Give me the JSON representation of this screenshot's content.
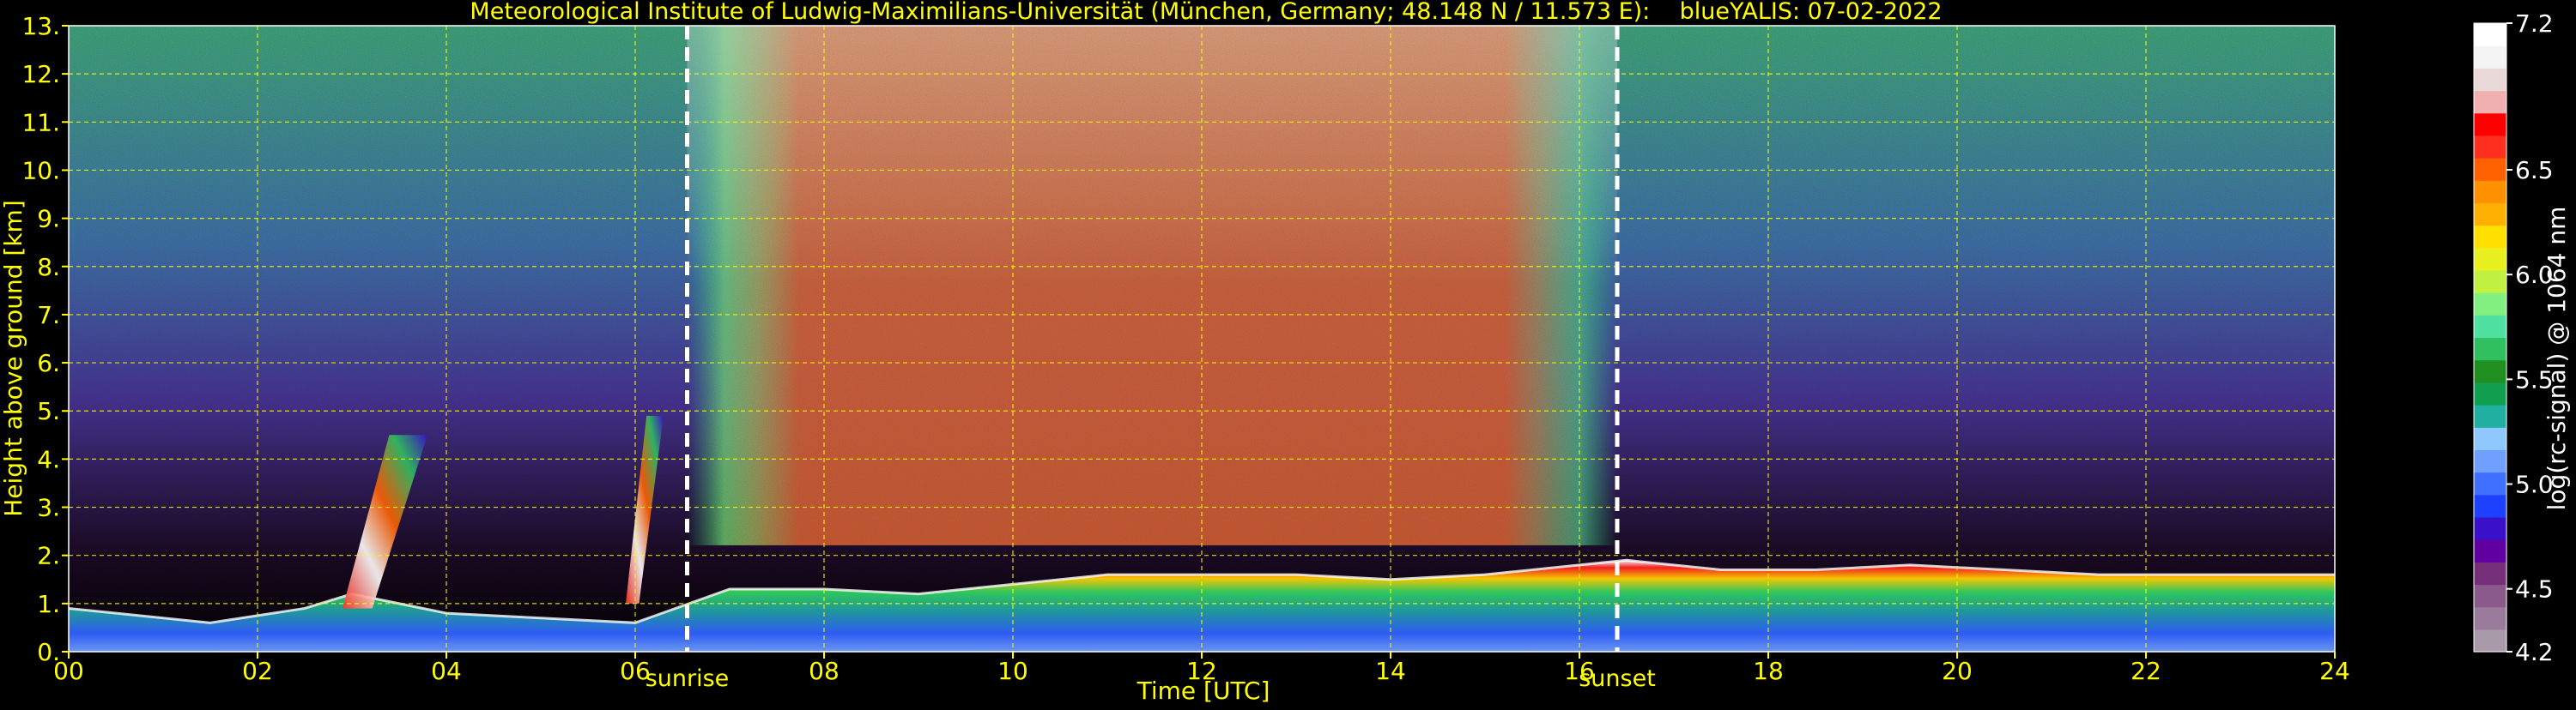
{
  "chart_data": {
    "type": "heatmap",
    "title": "Meteorological Institute of Ludwig-Maximilians-Universität (München, Germany; 48.148 N / 11.573 E):    blueYALIS: 07-02-2022",
    "xlabel": "Time [UTC]",
    "ylabel": "Height above ground [km]",
    "xlim": [
      0,
      24
    ],
    "ylim": [
      0,
      13
    ],
    "x_ticks": [
      0,
      2,
      4,
      6,
      8,
      10,
      12,
      14,
      16,
      18,
      20,
      22,
      24
    ],
    "x_tick_labels": [
      "00",
      "02",
      "04",
      "06",
      "08",
      "10",
      "12",
      "14",
      "16",
      "18",
      "20",
      "22",
      "24"
    ],
    "y_ticks": [
      0,
      1,
      2,
      3,
      4,
      5,
      6,
      7,
      8,
      9,
      10,
      11,
      12,
      13
    ],
    "y_tick_labels": [
      "0.",
      "1.",
      "2.",
      "3.",
      "4.",
      "5.",
      "6.",
      "7.",
      "8.",
      "9.",
      "10.",
      "11.",
      "12.",
      "13."
    ],
    "grid": true,
    "grid_color": "#ffff00",
    "annotations": [
      {
        "label": "sunrise",
        "x": 6.55
      },
      {
        "label": "sunset",
        "x": 16.4
      }
    ],
    "colorbar": {
      "label": "log(rc-signal) @ 1064 nm",
      "range": [
        4.2,
        7.2
      ],
      "tick_values": [
        4.2,
        4.5,
        5.0,
        5.5,
        6.0,
        6.5,
        7.2
      ],
      "tick_labels": [
        "4.2",
        "4.5",
        "5.0",
        "5.5",
        "6.0",
        "6.5",
        "7.2"
      ],
      "colors": [
        "#a89aa8",
        "#9b7b9b",
        "#8a5a8a",
        "#76307a",
        "#6000a0",
        "#3a10c8",
        "#1e40ff",
        "#4070ff",
        "#6fa0ff",
        "#8fc8ff",
        "#20b0a0",
        "#10a050",
        "#209020",
        "#30c060",
        "#50e0a0",
        "#80f080",
        "#c0f040",
        "#e8f020",
        "#ffe000",
        "#ffb000",
        "#ff9000",
        "#ff6000",
        "#ff3020",
        "#ff0000",
        "#f0b0b0",
        "#e8d8d8",
        "#f4f4f4",
        "#ffffff"
      ]
    },
    "pbl_height_km": [
      [
        0,
        0.9
      ],
      [
        1.5,
        0.6
      ],
      [
        2.5,
        0.9
      ],
      [
        3.0,
        1.2
      ],
      [
        4.0,
        0.8
      ],
      [
        5.0,
        0.7
      ],
      [
        6.0,
        0.6
      ],
      [
        7.0,
        1.3
      ],
      [
        8.0,
        1.3
      ],
      [
        9.0,
        1.2
      ],
      [
        10.0,
        1.4
      ],
      [
        11.0,
        1.6
      ],
      [
        12.0,
        1.6
      ],
      [
        13.0,
        1.6
      ],
      [
        14.0,
        1.5
      ],
      [
        15.0,
        1.6
      ],
      [
        16.0,
        1.8
      ],
      [
        16.5,
        1.9
      ],
      [
        17.5,
        1.7
      ],
      [
        18.5,
        1.7
      ],
      [
        19.5,
        1.8
      ],
      [
        20.5,
        1.7
      ],
      [
        21.5,
        1.6
      ],
      [
        22.5,
        1.6
      ],
      [
        23.5,
        1.6
      ],
      [
        24.0,
        1.6
      ]
    ],
    "cloud_plumes": [
      {
        "x0": 2.9,
        "x1": 3.8,
        "y0": 0.9,
        "y1": 4.5
      },
      {
        "x0": 5.9,
        "x1": 6.3,
        "y0": 1.0,
        "y1": 4.9
      }
    ]
  }
}
